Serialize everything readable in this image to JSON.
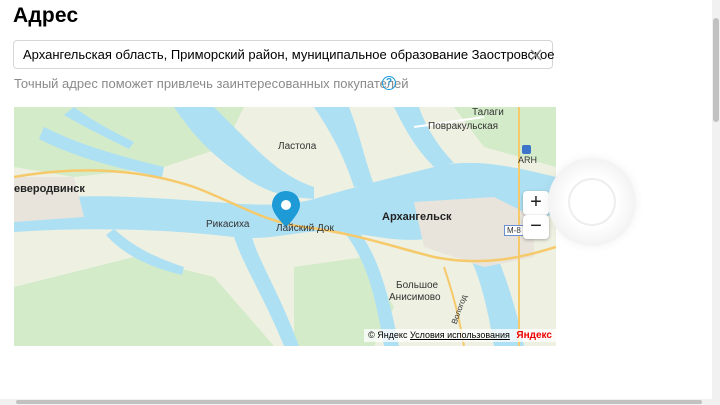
{
  "page": {
    "title": "Адрес"
  },
  "address": {
    "value": "Архангельская область, Приморский район, муниципальное образование Заостровское",
    "clear_icon": "close-icon"
  },
  "hint": {
    "text": "Точный адрес поможет привлечь заинтересованных покупателей",
    "help_icon": "?"
  },
  "map": {
    "labels": {
      "talagi": "Талаги",
      "povrakulskaya": "Повракульская",
      "lastola": "Ластола",
      "severodvinsk": "еверодвинск",
      "arkhangelsk": "Архангельск",
      "rikasikha": "Рикасиха",
      "layskiy_dok": "Лайский Док",
      "bolshoe_anisimovo_1": "Большое",
      "bolshoe_anisimovo_2": "Анисимово",
      "arh_airport": "ARH",
      "m8": "М-8",
      "vologodskaya": "Вологод"
    },
    "zoom_in": "+",
    "zoom_out": "−",
    "copyright": "© Яндекс",
    "terms": "Условия использования",
    "logo": "Яндекс",
    "marker_color": "#1e9bd7",
    "water_color": "#aee0f4"
  }
}
